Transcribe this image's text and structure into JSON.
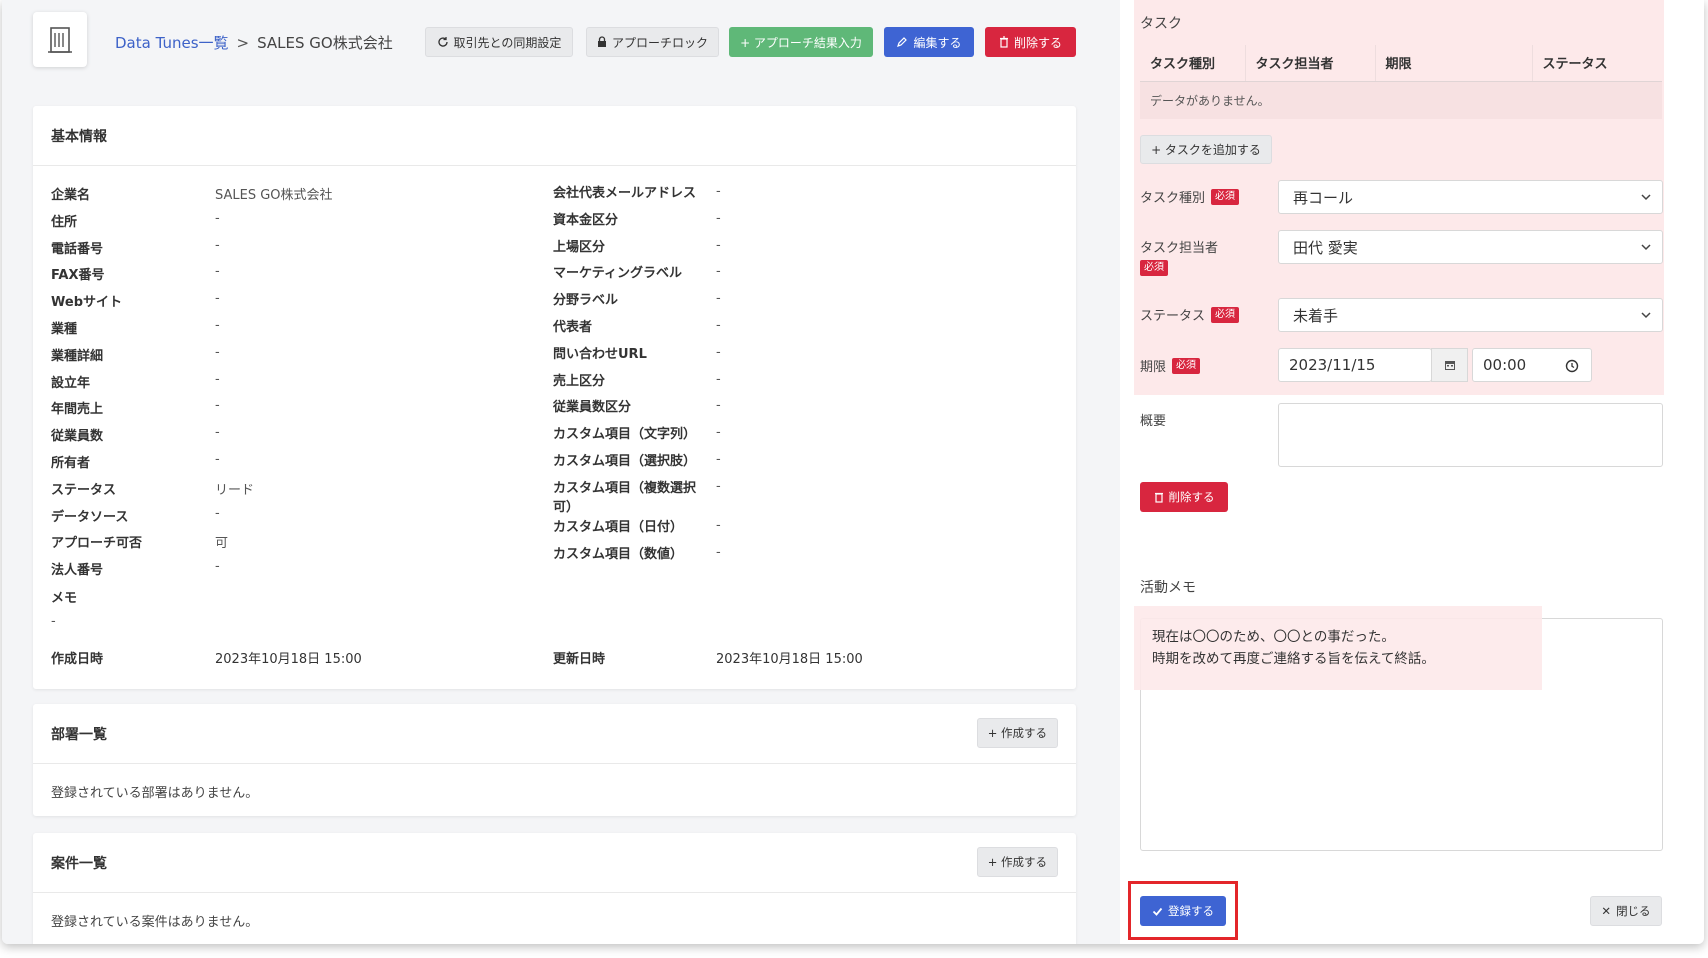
{
  "breadcrumb": {
    "link": "Data Tunes一覧",
    "separator": ">",
    "current": "SALES GO株式会社"
  },
  "toolbar": {
    "sync_label": "取引先との同期設定",
    "lock_label": "アプローチロック",
    "approach_label": "+ アプローチ結果入力",
    "edit_label": "編集する",
    "delete_label": "削除する"
  },
  "basic_info": {
    "title": "基本情報",
    "left_fields": [
      {
        "label": "企業名",
        "value": "SALES GO株式会社"
      },
      {
        "label": "住所",
        "value": "-"
      },
      {
        "label": "電話番号",
        "value": "-"
      },
      {
        "label": "FAX番号",
        "value": "-"
      },
      {
        "label": "Webサイト",
        "value": "-"
      },
      {
        "label": "業種",
        "value": "-"
      },
      {
        "label": "業種詳細",
        "value": "-"
      },
      {
        "label": "設立年",
        "value": "-"
      },
      {
        "label": "年間売上",
        "value": "-"
      },
      {
        "label": "従業員数",
        "value": "-"
      },
      {
        "label": "所有者",
        "value": "-"
      },
      {
        "label": "ステータス",
        "value": "リード"
      },
      {
        "label": "データソース",
        "value": "-"
      },
      {
        "label": "アプローチ可否",
        "value": "可"
      },
      {
        "label": "法人番号",
        "value": "-"
      }
    ],
    "right_fields": [
      {
        "label": "会社代表メールアドレス",
        "value": "-"
      },
      {
        "label": "資本金区分",
        "value": "-"
      },
      {
        "label": "上場区分",
        "value": "-"
      },
      {
        "label": "マーケティングラベル",
        "value": "-"
      },
      {
        "label": "分野ラベル",
        "value": "-"
      },
      {
        "label": "代表者",
        "value": "-"
      },
      {
        "label": "問い合わせURL",
        "value": "-"
      },
      {
        "label": "売上区分",
        "value": "-"
      },
      {
        "label": "従業員数区分",
        "value": "-"
      },
      {
        "label": "カスタム項目（文字列）",
        "value": "-"
      },
      {
        "label": "カスタム項目（選択肢）",
        "value": "-"
      },
      {
        "label": "カスタム項目（複数選択可）",
        "value": "-"
      },
      {
        "label": "カスタム項目（日付）",
        "value": "-"
      },
      {
        "label": "カスタム項目（数値）",
        "value": "-"
      }
    ],
    "memo_label": "メモ",
    "memo_value": "-",
    "created_label": "作成日時",
    "created_value": "2023年10月18日 15:00",
    "updated_label": "更新日時",
    "updated_value": "2023年10月18日 15:00"
  },
  "departments": {
    "title": "部署一覧",
    "create_label": "+ 作成する",
    "empty": "登録されている部署はありません。"
  },
  "deals": {
    "title": "案件一覧",
    "create_label": "+ 作成する",
    "empty": "登録されている案件はありません。"
  },
  "task_panel": {
    "title": "タスク",
    "columns": [
      "タスク種別",
      "タスク担当者",
      "期限",
      "ステータス"
    ],
    "empty": "データがありません。",
    "add_label": "+ タスクを追加する",
    "required": "必須",
    "type_label": "タスク種別",
    "type_value": "再コール",
    "assignee_label": "タスク担当者",
    "assignee_value": "田代 愛実",
    "status_label": "ステータス",
    "status_value": "未着手",
    "due_label": "期限",
    "due_date": "2023/11/15",
    "due_time": "00:00",
    "summary_label": "概要",
    "delete_label": "削除する"
  },
  "activity": {
    "title": "活動メモ",
    "line1": "現在は〇〇のため、〇〇との事だった。",
    "line2": "時期を改めて再度ご連絡する旨を伝えて終話。"
  },
  "footer": {
    "submit_label": "登録する",
    "close_label": "閉じる"
  },
  "colors": {
    "primary": "#3e64d3",
    "danger": "#d8263f",
    "success": "#5fb878",
    "highlight": "#fde9ea",
    "callout": "#e3262a"
  }
}
